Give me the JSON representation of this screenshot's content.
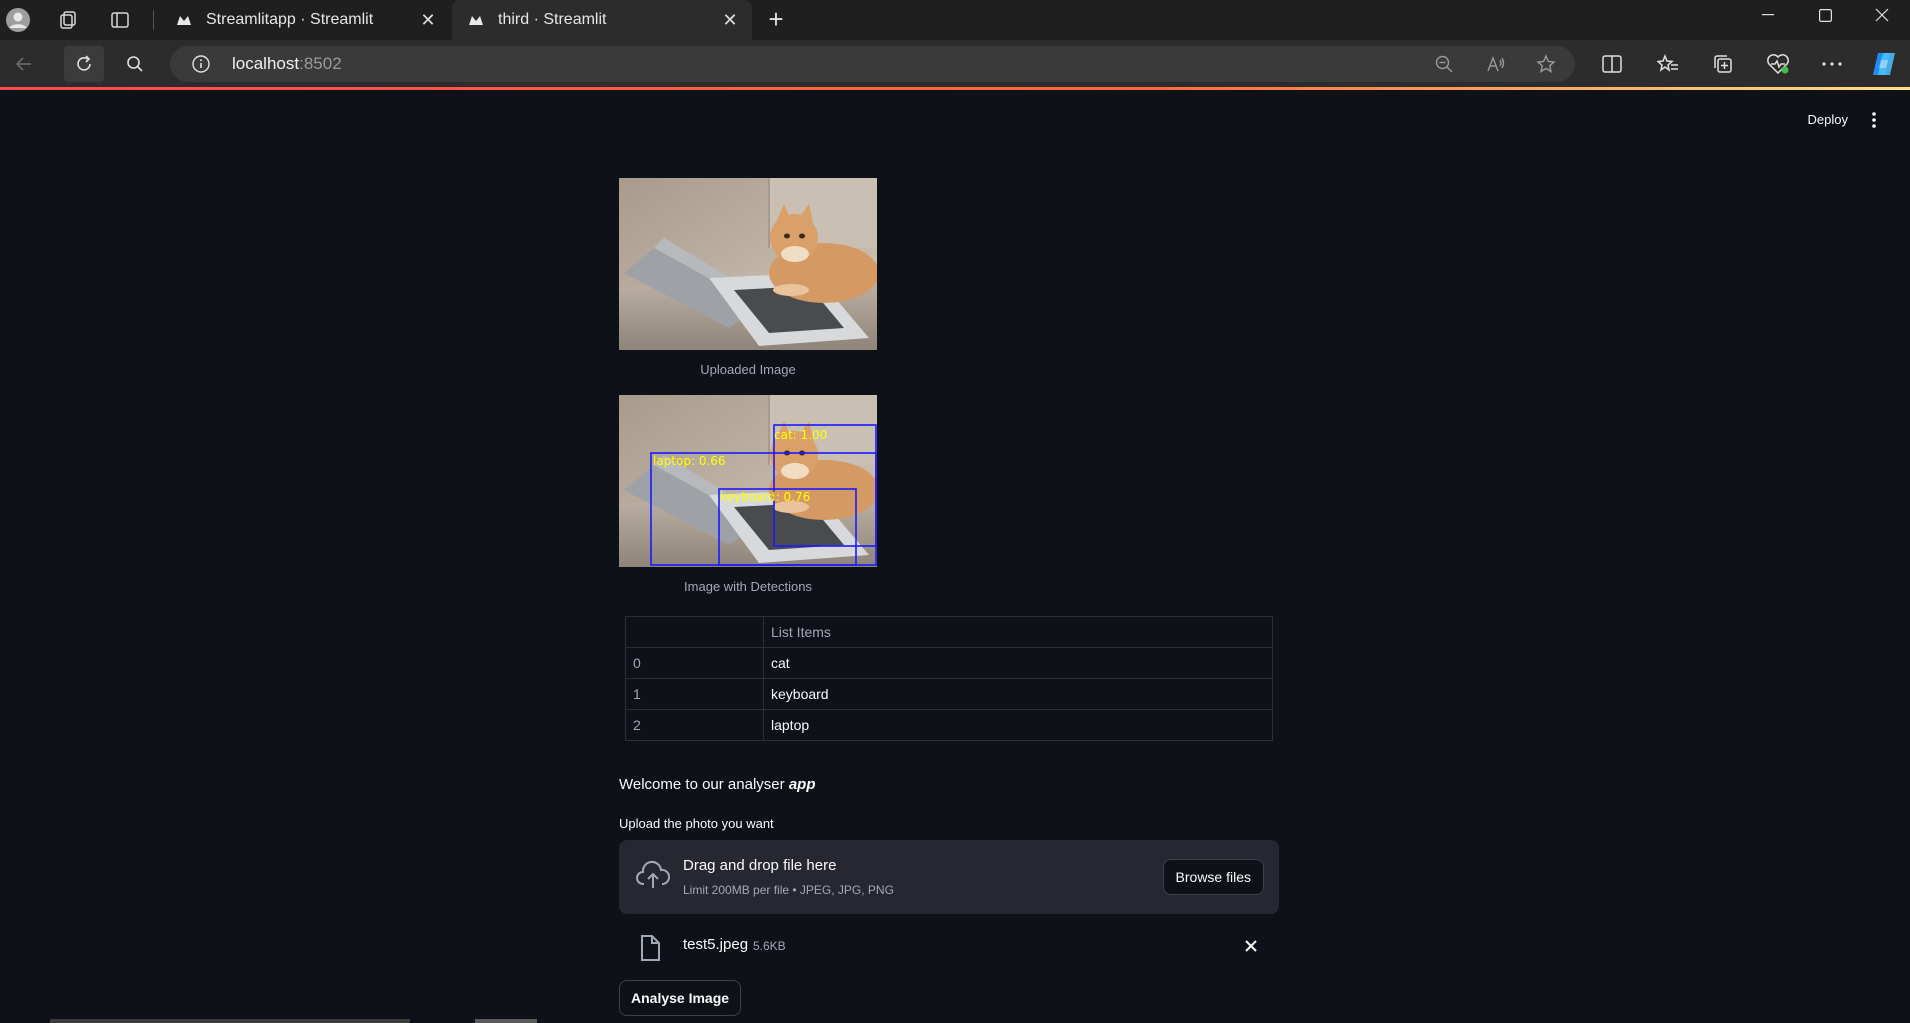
{
  "browser": {
    "tabs": [
      {
        "title": "Streamlitapp · Streamlit",
        "active": false
      },
      {
        "title": "third · Streamlit",
        "active": true
      }
    ],
    "url_host": "localhost",
    "url_port": ":8502"
  },
  "app": {
    "deploy_label": "Deploy",
    "uploaded_caption": "Uploaded Image",
    "detections_caption": "Image with Detections",
    "detections": [
      {
        "label": "cat: 1.00"
      },
      {
        "label": "laptop: 0.66"
      },
      {
        "label": "keyboard: 0.76"
      }
    ],
    "table": {
      "header_index": "",
      "header_col": "List Items",
      "rows": [
        {
          "index": "0",
          "value": "cat"
        },
        {
          "index": "1",
          "value": "keyboard"
        },
        {
          "index": "2",
          "value": "laptop"
        }
      ]
    },
    "welcome_prefix": "Welcome to our analyser ",
    "welcome_emph": "app",
    "upload_label": "Upload the photo you want",
    "dropzone_title": "Drag and drop file here",
    "dropzone_limit": "Limit 200MB per file • JPEG, JPG, PNG",
    "browse_label": "Browse files",
    "file_name": "test5.jpeg",
    "file_size": "5.6KB",
    "analyse_label": "Analyse Image"
  },
  "colors": {
    "background": "#0e1117",
    "secondary_bg": "#262730",
    "accent": "#ff4b4b",
    "bbox": "#1a1aff",
    "bbox_label": "#ffff00"
  }
}
